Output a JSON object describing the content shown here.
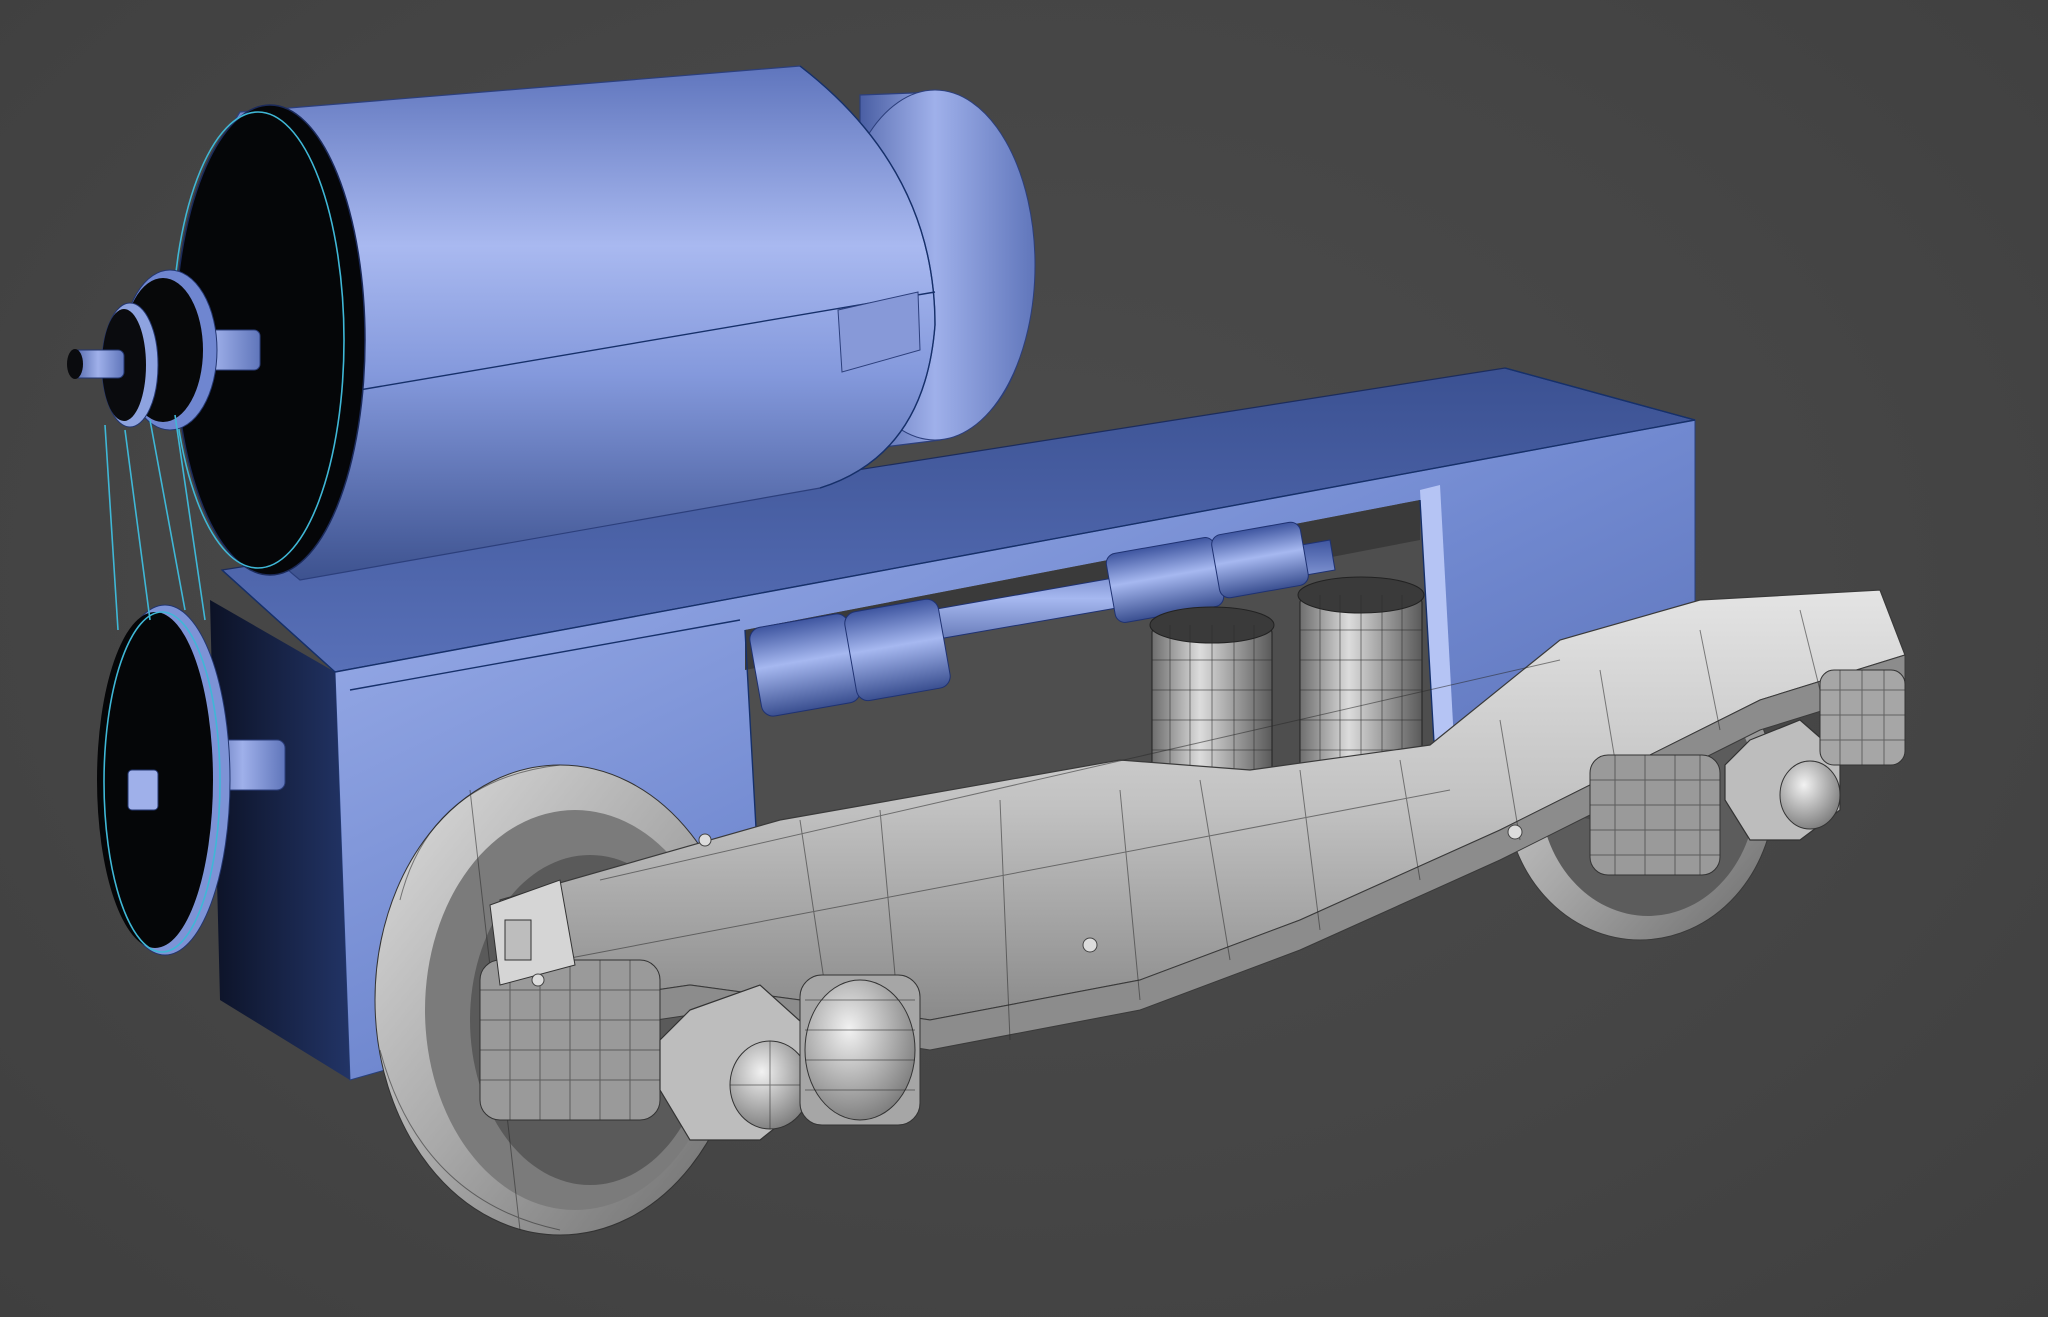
{
  "viewport": {
    "background_color": "#474747",
    "scene_label": "",
    "object_colors": {
      "motor": "#8ea3e0",
      "motor_dark": "#3a4f8f",
      "bogie_frame": "#c9c9c9",
      "bogie_dark": "#7d7d7d",
      "selection_outline": "#3fb7d6"
    }
  }
}
